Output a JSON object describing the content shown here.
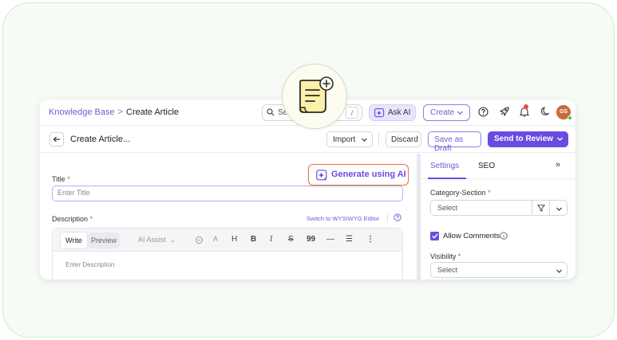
{
  "breadcrumb": {
    "root": "Knowledge Base",
    "separator": ">",
    "current": "Create Article"
  },
  "search": {
    "placeholder": "Se",
    "shortcut": "/"
  },
  "topbar": {
    "ask_ai": "Ask AI",
    "create": "Create",
    "avatar_initials": "GS"
  },
  "subbar": {
    "title": "Create Article...",
    "import": "Import",
    "discard": "Discard",
    "save_draft": "Save as Draft",
    "send_review": "Send to Review"
  },
  "form": {
    "title_label": "Title",
    "title_placeholder": "Enter Title",
    "description_label": "Description",
    "switch_editor": "Switch to WYSIWYG Editor",
    "tab_write": "Write",
    "tab_preview": "Preview",
    "ai_assist": "AI Assist",
    "description_placeholder": "Enter Description",
    "required_mark": "*"
  },
  "generate": {
    "label": "Generate using AI"
  },
  "sidebar": {
    "tab_settings": "Settings",
    "tab_seo": "SEO",
    "collapse": "»",
    "category_label": "Category-Section",
    "category_value": "Select",
    "allow_comments": "Allow Comments",
    "visibility_label": "Visibility",
    "visibility_value": "Select"
  },
  "colors": {
    "accent": "#6a4be0",
    "highlight": "#e8773f",
    "frame": "#cfeccb"
  }
}
